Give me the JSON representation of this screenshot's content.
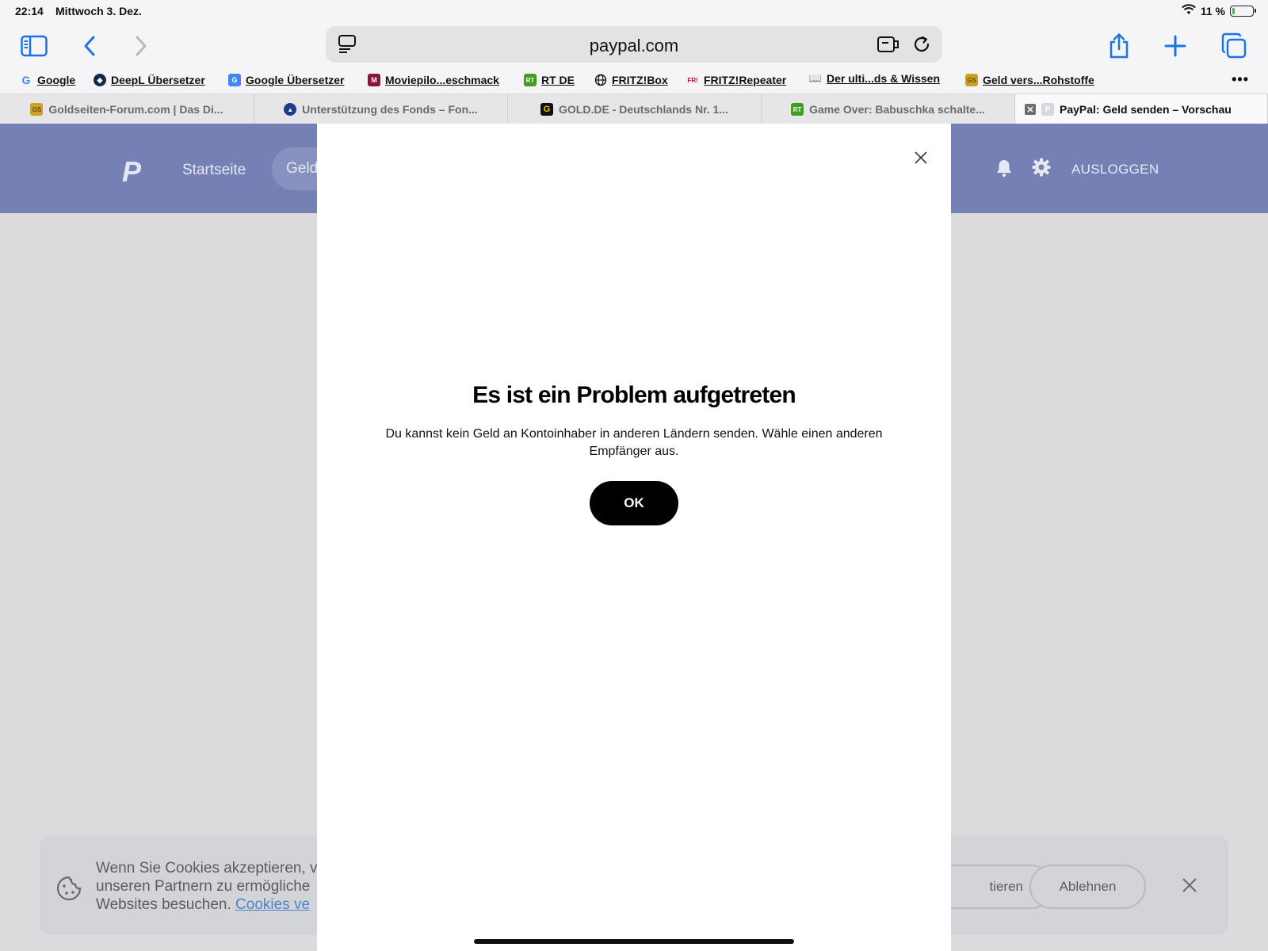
{
  "status": {
    "time": "22:14",
    "date": "Mittwoch 3. Dez.",
    "battery_text": "11 %",
    "battery_level": 0.11,
    "battery_color": "#36c24a"
  },
  "toolbar": {
    "url": "paypal.com"
  },
  "bookmarks": [
    {
      "label": "Google",
      "icon": "google-icon"
    },
    {
      "label": "DeepL Übersetzer",
      "icon": "deepl-icon"
    },
    {
      "label": "Google Übersetzer",
      "icon": "google-translate-icon"
    },
    {
      "label": "Moviepilo...eschmack",
      "icon": "moviepilot-icon"
    },
    {
      "label": "RT DE",
      "icon": "rt-icon"
    },
    {
      "label": "FRITZ!Box",
      "icon": "globe-icon"
    },
    {
      "label": "FRITZ!Repeater",
      "icon": "fritz-icon"
    },
    {
      "label": "Der ulti...ds & Wissen",
      "icon": "book-icon"
    },
    {
      "label": "Geld vers...Rohstoffe",
      "icon": "goldseiten-icon"
    }
  ],
  "bookmarks_more": "•••",
  "tabs": [
    {
      "label": "Goldseiten-Forum.com | Das Di...",
      "icon": "goldseiten-icon"
    },
    {
      "label": "Unterstützung des Fonds – Fon...",
      "icon": "fund-icon"
    },
    {
      "label": "GOLD.DE - Deutschlands Nr. 1...",
      "icon": "gold-de-icon"
    },
    {
      "label": "Game Over: Babuschka schalte...",
      "icon": "rt-icon"
    },
    {
      "label": "PayPal: Geld senden – Vorschau",
      "icon": "paypal-tab-icon",
      "active": true
    }
  ],
  "paypal": {
    "logo": "P",
    "nav": [
      "Startseite",
      "Geld"
    ],
    "logout": "AUSLOGGEN",
    "header_color": "#7581b4"
  },
  "cookie": {
    "line1": "Wenn Sie Cookies akzeptieren, v",
    "line2": "unseren Partnern zu ermögliche",
    "line3": "Websites besuchen.",
    "link": "Cookies ve",
    "accept": "tieren",
    "decline": "Ablehnen"
  },
  "modal": {
    "title": "Es ist ein Problem aufgetreten",
    "message": "Du kannst kein Geld an Kontoinhaber in anderen Ländern senden. Wähle einen anderen Empfänger aus.",
    "ok": "OK"
  }
}
